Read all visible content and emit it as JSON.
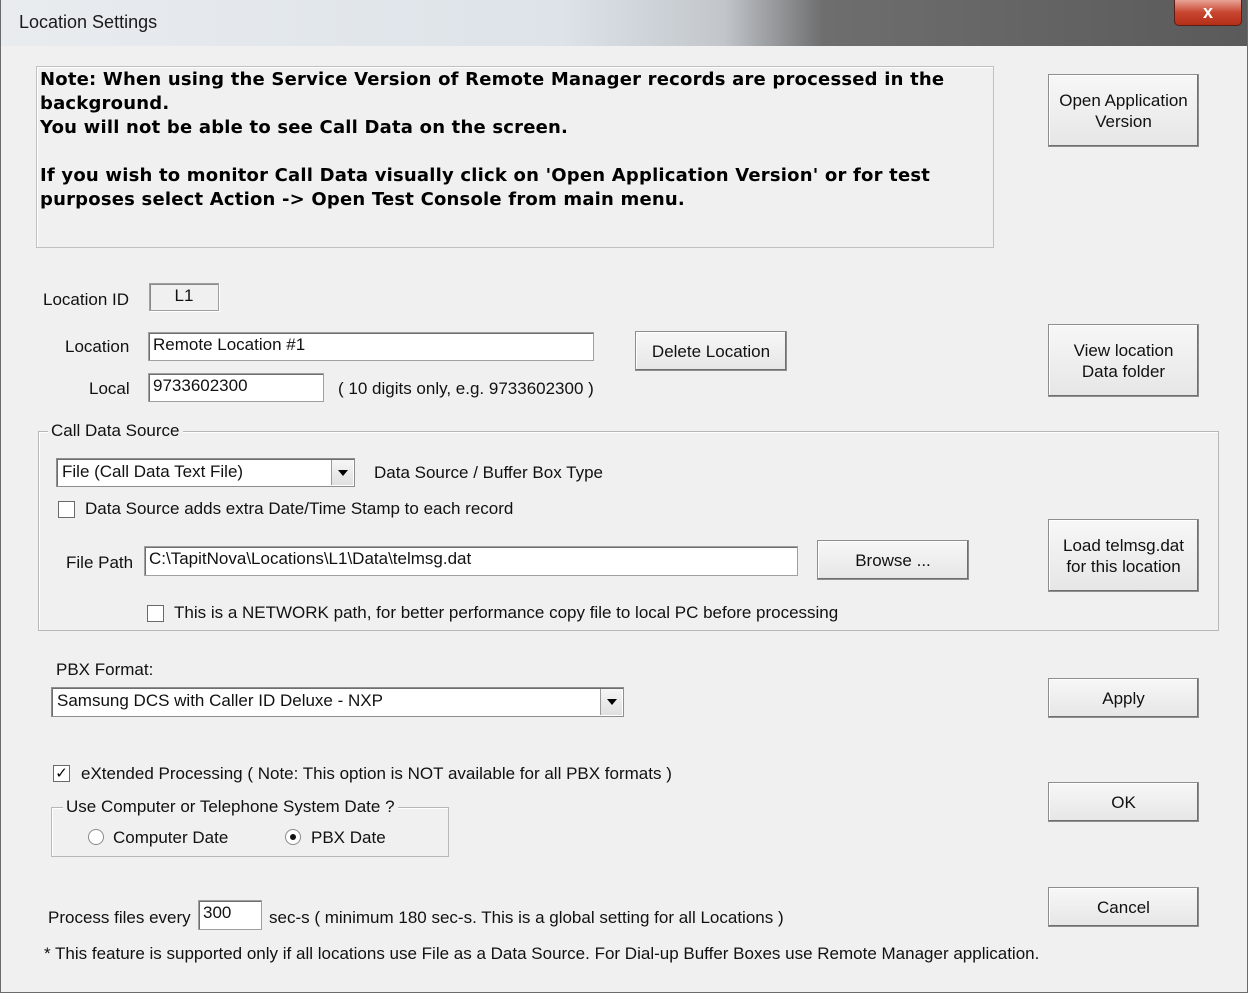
{
  "window": {
    "title": "Location Settings",
    "close_label": "x"
  },
  "note": {
    "lines": [
      "Note: When using the Service Version of Remote Manager records are processed in the",
      "background.",
      "You will not be able to see Call Data on the screen.",
      "",
      "If you wish to monitor Call Data visually click on 'Open Application Version' or for test",
      "purposes select Action -> Open Test Console from main menu."
    ]
  },
  "buttons": {
    "open_app_version": [
      "Open Application",
      "Version"
    ],
    "view_location_folder": [
      "View location",
      "Data folder"
    ],
    "delete_location": "Delete Location",
    "browse": "Browse ...",
    "load_telmsg": [
      "Load telmsg.dat",
      "for this location"
    ],
    "apply": "Apply",
    "ok": "OK",
    "cancel": "Cancel"
  },
  "location": {
    "id_label": "Location ID",
    "id_value": "L1",
    "name_label": "Location",
    "name_value": "Remote Location #1",
    "local_label": "Local",
    "local_value": "9733602300",
    "local_hint": "( 10 digits only, e.g. 9733602300 )"
  },
  "call_data_source": {
    "group_title": "Call Data Source",
    "source_selected": "File  (Call Data Text File)",
    "source_label": "Data Source / Buffer Box Type",
    "extra_stamp_label": "Data Source adds extra Date/Time Stamp to each record",
    "extra_stamp_checked": false,
    "file_path_label": "File Path",
    "file_path_value": "C:\\TapitNova\\Locations\\L1\\Data\\telmsg.dat",
    "network_label": "This is a NETWORK path, for better performance copy file to local PC before processing",
    "network_checked": false
  },
  "pbx": {
    "format_label": "PBX Format:",
    "format_selected": "Samsung DCS with Caller ID Deluxe - NXP"
  },
  "extended": {
    "label": "eXtended Processing ( Note: This option is NOT available for all PBX formats )",
    "checked": true,
    "check_glyph": "✓"
  },
  "date_source": {
    "group_title": "Use Computer or Telephone System Date ?",
    "computer_label": "Computer Date",
    "pbx_label": "PBX Date",
    "selected": "PBX Date"
  },
  "process": {
    "label": "Process files every",
    "value": "300",
    "hint": "sec-s  ( minimum 180 sec-s. This is a global setting for all Locations )",
    "footnote": "* This feature is supported only if all locations use File as a Data Source.  For Dial-up Buffer Boxes use Remote Manager application."
  }
}
